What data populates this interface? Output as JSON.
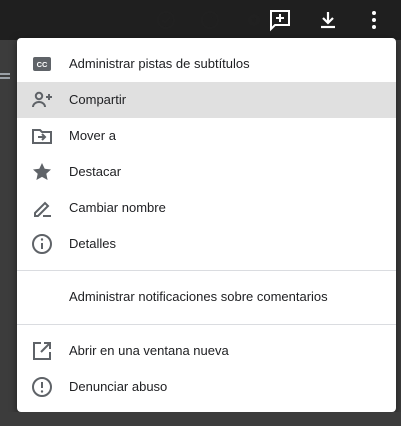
{
  "menu": {
    "items": [
      {
        "label": "Administrar pistas de subtítulos",
        "icon": "subtitles-icon"
      },
      {
        "label": "Compartir",
        "icon": "person-add-icon",
        "highlighted": true
      },
      {
        "label": "Mover a",
        "icon": "move-to-folder-icon"
      },
      {
        "label": "Destacar",
        "icon": "star-icon"
      },
      {
        "label": "Cambiar nombre",
        "icon": "edit-pencil-icon"
      },
      {
        "label": "Detalles",
        "icon": "info-icon"
      }
    ],
    "notifications_label": "Administrar notificaciones sobre comentarios",
    "open_new_window_label": "Abrir en una ventana nueva",
    "report_abuse_label": "Denunciar abuso"
  },
  "colors": {
    "menu_bg": "#ffffff",
    "highlight": "#e0e0e0",
    "icon": "#5f6368",
    "text": "#202124",
    "toolbar_icon": "#ffffff"
  }
}
